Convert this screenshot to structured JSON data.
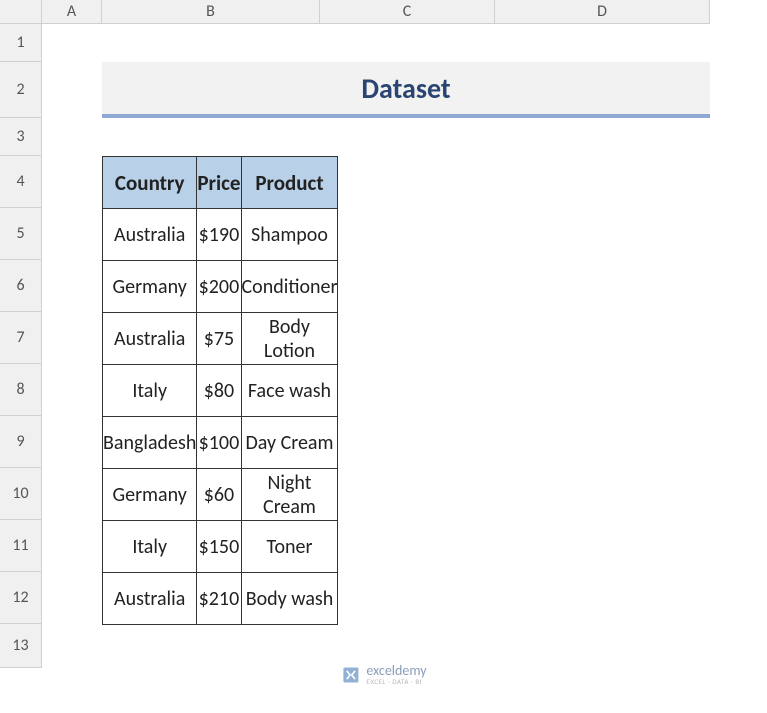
{
  "columns": {
    "a": "A",
    "b": "B",
    "c": "C",
    "d": "D"
  },
  "rows": {
    "r1": "1",
    "r2": "2",
    "r3": "3",
    "r4": "4",
    "r5": "5",
    "r6": "6",
    "r7": "7",
    "r8": "8",
    "r9": "9",
    "r10": "10",
    "r11": "11",
    "r12": "12",
    "r13": "13"
  },
  "title": "Dataset",
  "headers": {
    "country": "Country",
    "price": "Price",
    "product": "Product"
  },
  "data": [
    {
      "country": "Australia",
      "price": "$190",
      "product": "Shampoo"
    },
    {
      "country": "Germany",
      "price": "$200",
      "product": "Conditioner"
    },
    {
      "country": "Australia",
      "price": "$75",
      "product": "Body Lotion"
    },
    {
      "country": "Italy",
      "price": "$80",
      "product": "Face wash"
    },
    {
      "country": "Bangladesh",
      "price": "$100",
      "product": "Day Cream"
    },
    {
      "country": "Germany",
      "price": "$60",
      "product": "Night Cream"
    },
    {
      "country": "Italy",
      "price": "$150",
      "product": "Toner"
    },
    {
      "country": "Australia",
      "price": "$210",
      "product": "Body wash"
    }
  ],
  "watermark": {
    "main": "exceldemy",
    "sub": "EXCEL · DATA · BI"
  }
}
